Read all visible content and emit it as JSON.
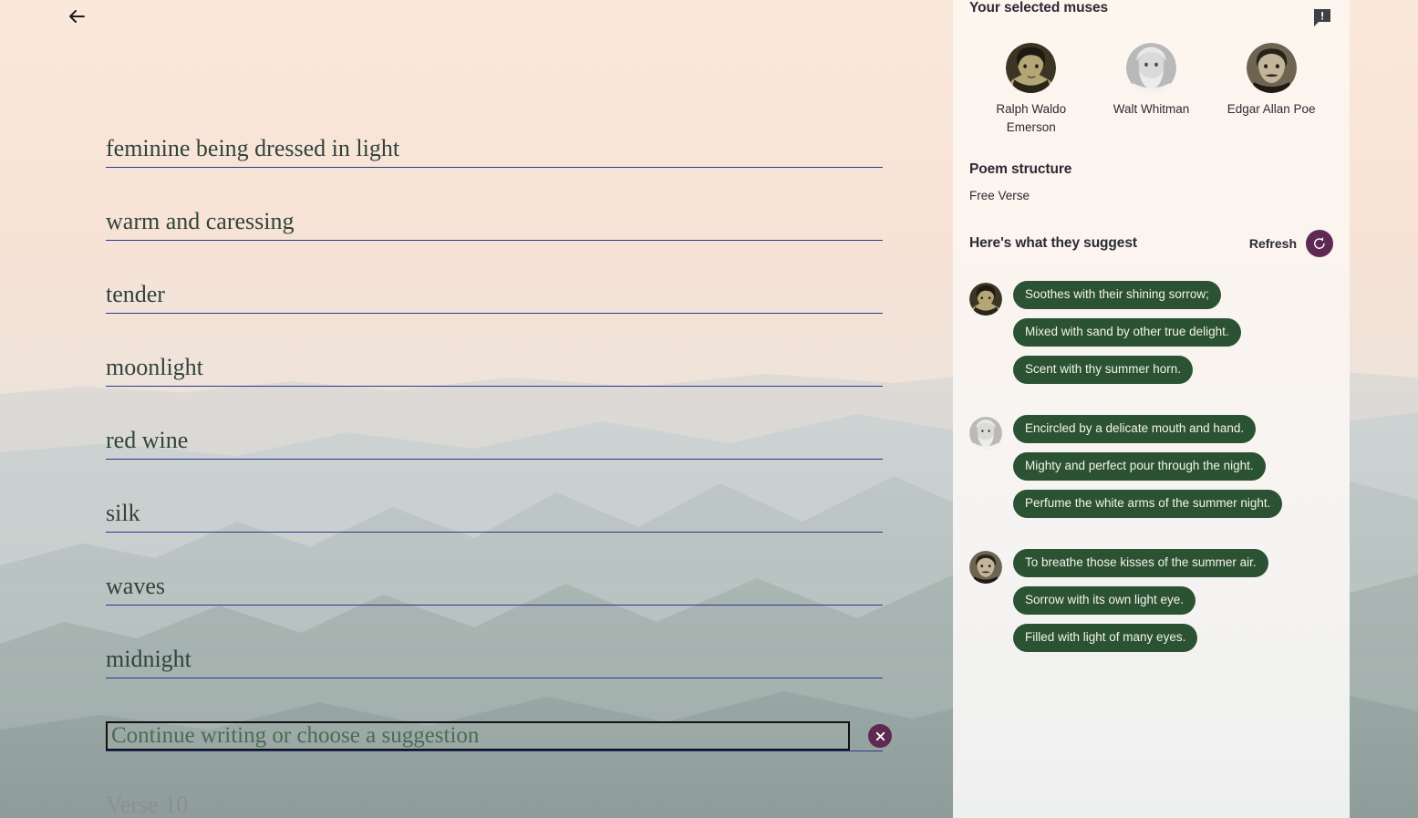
{
  "nav": {
    "back_icon": "arrow-left-icon"
  },
  "poem": {
    "verses": [
      "feminine being dressed in light",
      "warm and caressing",
      "tender",
      "moonlight",
      "red wine",
      "silk",
      "waves",
      "midnight"
    ],
    "active_placeholder": "Continue writing or choose a suggestion",
    "next_placeholder": "Verse 10",
    "clear_icon": "close-x-icon"
  },
  "panel": {
    "muses_title": "Your selected muses",
    "report_icon": "feedback-bubble-icon",
    "muses": [
      {
        "name": "Ralph Waldo Emerson"
      },
      {
        "name": "Walt Whitman"
      },
      {
        "name": "Edgar Allan Poe"
      }
    ],
    "structure_title": "Poem structure",
    "structure_value": "Free Verse",
    "suggest_title": "Here's what they suggest",
    "refresh_label": "Refresh",
    "refresh_icon": "refresh-ccw-icon",
    "suggestion_groups": [
      {
        "muse": "Ralph Waldo Emerson",
        "chips": [
          "Soothes with their shining sorrow;",
          "Mixed with sand by other true delight.",
          "Scent with thy summer horn."
        ]
      },
      {
        "muse": "Walt Whitman",
        "chips": [
          "Encircled by a delicate mouth and hand.",
          "Mighty and perfect pour through the night.",
          "Perfume the white arms of the summer night."
        ]
      },
      {
        "muse": "Edgar Allan Poe",
        "chips": [
          "To breathe those kisses of the summer air.",
          "Sorrow with its own light eye.",
          "Filled with light of many eyes."
        ]
      }
    ]
  },
  "colors": {
    "chip_green": "#2b5233",
    "accent_purple": "#5e2a54",
    "verse_underline": "#2b3a8c",
    "verse_text": "#30433c",
    "panel_bg": "#fdf6ef"
  }
}
